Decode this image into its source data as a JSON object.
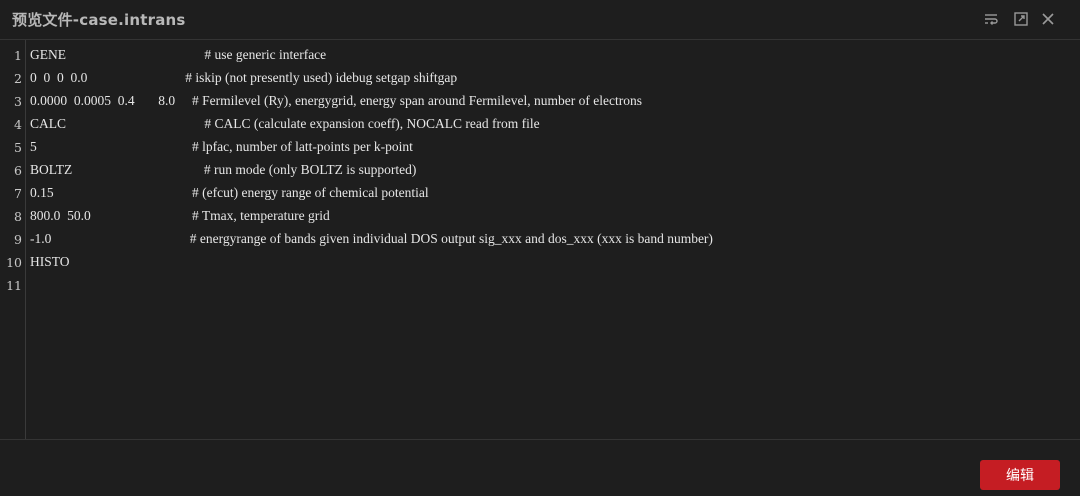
{
  "dialog": {
    "title": "预览文件-case.intrans"
  },
  "titlebar_icons": [
    "wrap-lines-icon",
    "maximize-icon",
    "close-icon"
  ],
  "editor": {
    "line_numbers": [
      "1",
      "2",
      "3",
      "4",
      "5",
      "6",
      "7",
      "8",
      "9",
      "10",
      "11"
    ],
    "lines": [
      "GENE                                         # use generic interface",
      "0  0  0  0.0                             # iskip (not presently used) idebug setgap shiftgap",
      "0.0000  0.0005  0.4       8.0     # Fermilevel (Ry), energygrid, energy span around Fermilevel, number of electrons",
      "CALC                                         # CALC (calculate expansion coeff), NOCALC read from file",
      "5                                              # lpfac, number of latt-points per k-point",
      "BOLTZ                                       # run mode (only BOLTZ is supported)",
      "0.15                                         # (efcut) energy range of chemical potential",
      "800.0  50.0                              # Tmax, temperature grid",
      "-1.0                                         # energyrange of bands given individual DOS output sig_xxx and dos_xxx (xxx is band number)",
      "HISTO",
      ""
    ]
  },
  "footer": {
    "edit_label": "编辑"
  },
  "colors": {
    "background": "#1e1e1e",
    "text": "#e6e6e6",
    "accent_button": "#c51d23"
  }
}
